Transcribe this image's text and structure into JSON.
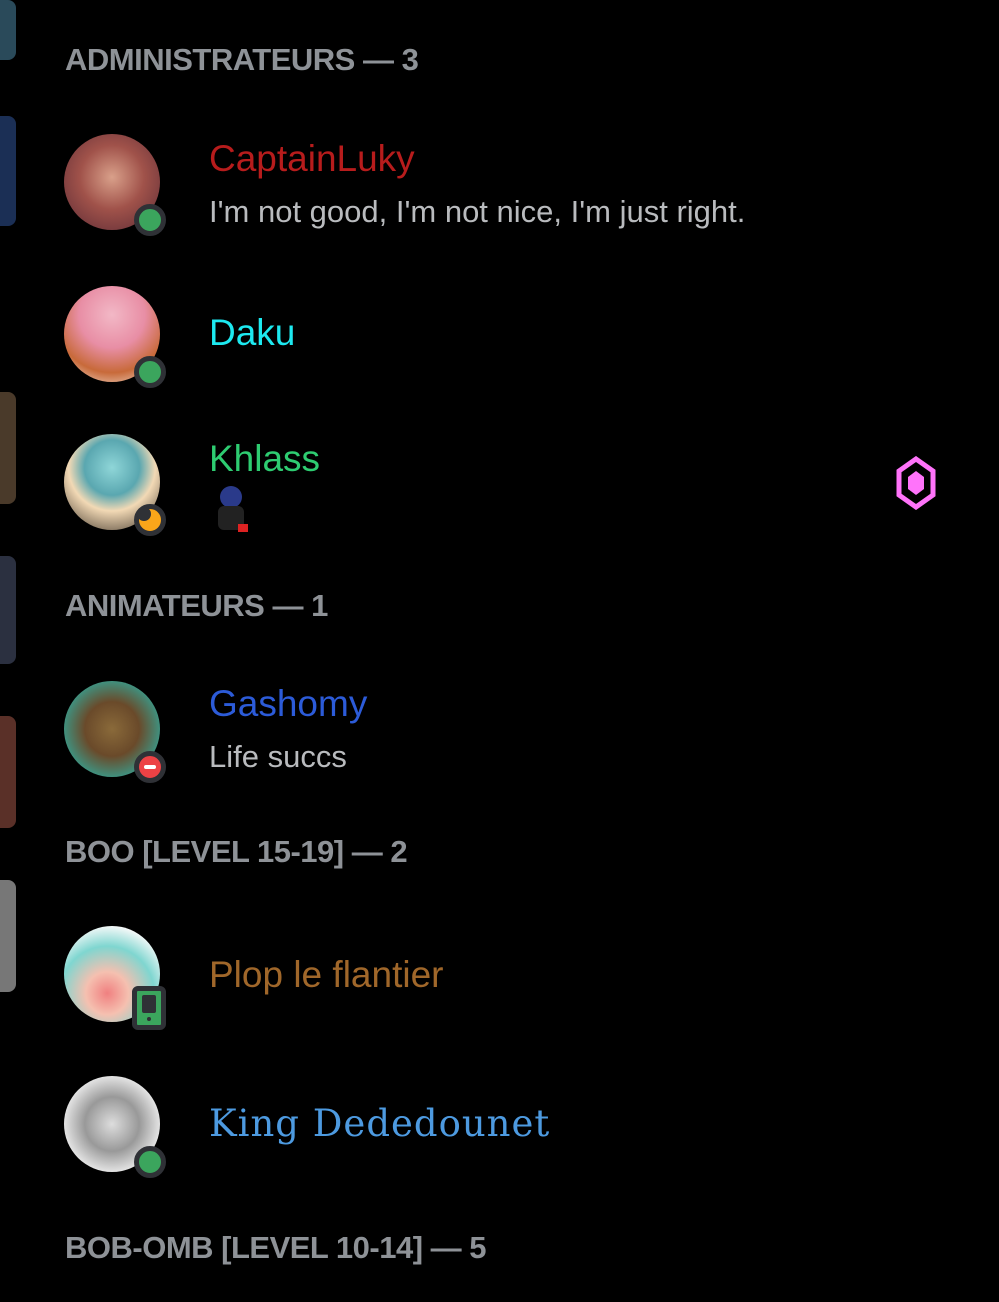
{
  "sections": [
    {
      "title": "ADMINISTRATEURS — 3"
    },
    {
      "title": "ANIMATEURS — 1"
    },
    {
      "title": "BOO [LEVEL 15-19] — 2"
    },
    {
      "title": "BOB-OMB [LEVEL 10-14] — 5"
    }
  ],
  "members": [
    {
      "name": "CaptainLuky",
      "status_text": "I'm not good, I'm not nice, I'm just right.",
      "status": "online",
      "color": "#b71c1c"
    },
    {
      "name": "Daku",
      "status": "online",
      "color": "#1de9f0"
    },
    {
      "name": "Khlass",
      "status": "idle",
      "color": "#2ecc71",
      "badge_icon": "nitro-boost-gem-icon",
      "badge_color": "#ff73fa"
    },
    {
      "name": "Gashomy",
      "status_text": "Life succs",
      "status": "dnd",
      "color": "#2c5bd8"
    },
    {
      "name": "Plop le flantier",
      "status": "mobile",
      "color": "#a0672a"
    },
    {
      "name": "King Dededounet",
      "status": "online",
      "color": "#4d9ae0"
    }
  ]
}
